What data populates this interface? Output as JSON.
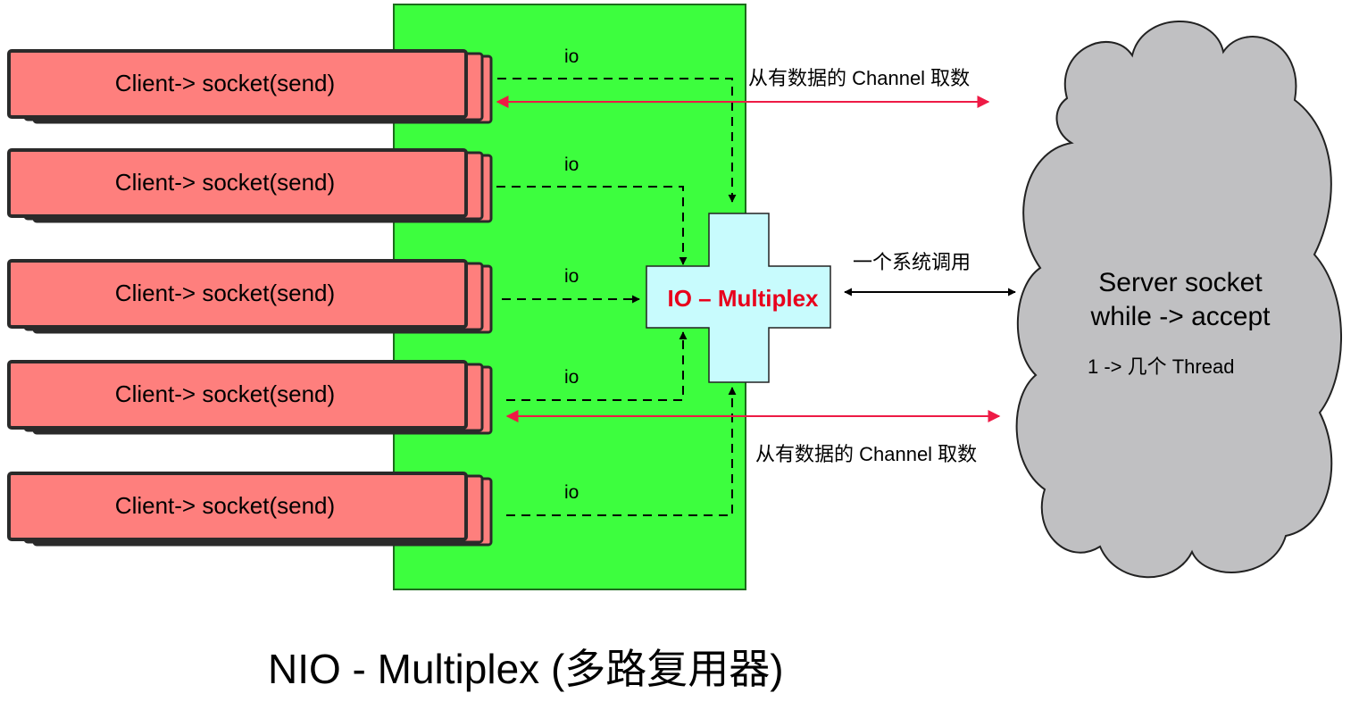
{
  "clients": [
    {
      "label": "Client-> socket(send)",
      "io_label": "io"
    },
    {
      "label": "Client-> socket(send)",
      "io_label": "io"
    },
    {
      "label": "Client-> socket(send)",
      "io_label": "io"
    },
    {
      "label": "Client-> socket(send)",
      "io_label": "io"
    },
    {
      "label": "Client-> socket(send)",
      "io_label": "io"
    }
  ],
  "multiplex": {
    "label": "IO – Multiplex"
  },
  "annotations": {
    "top_channel": "从有数据的 Channel  取数",
    "syscall": "一个系统调用",
    "bottom_channel": "从有数据的 Channel  取数"
  },
  "server": {
    "line1": "Server socket",
    "line2": "while -> accept",
    "thread": "1 -> 几个 Thread"
  },
  "title": "NIO - Multiplex (多路复用器)",
  "colors": {
    "client_fill": "#fe7f7d",
    "client_stroke": "#2a2a2a",
    "panel_green": "#3dfe3e",
    "multiplex_fill": "#c8fbfd",
    "multiplex_text": "#e8001c",
    "red_arrow": "#ee1a45",
    "cloud_fill": "#c0c0c2"
  }
}
